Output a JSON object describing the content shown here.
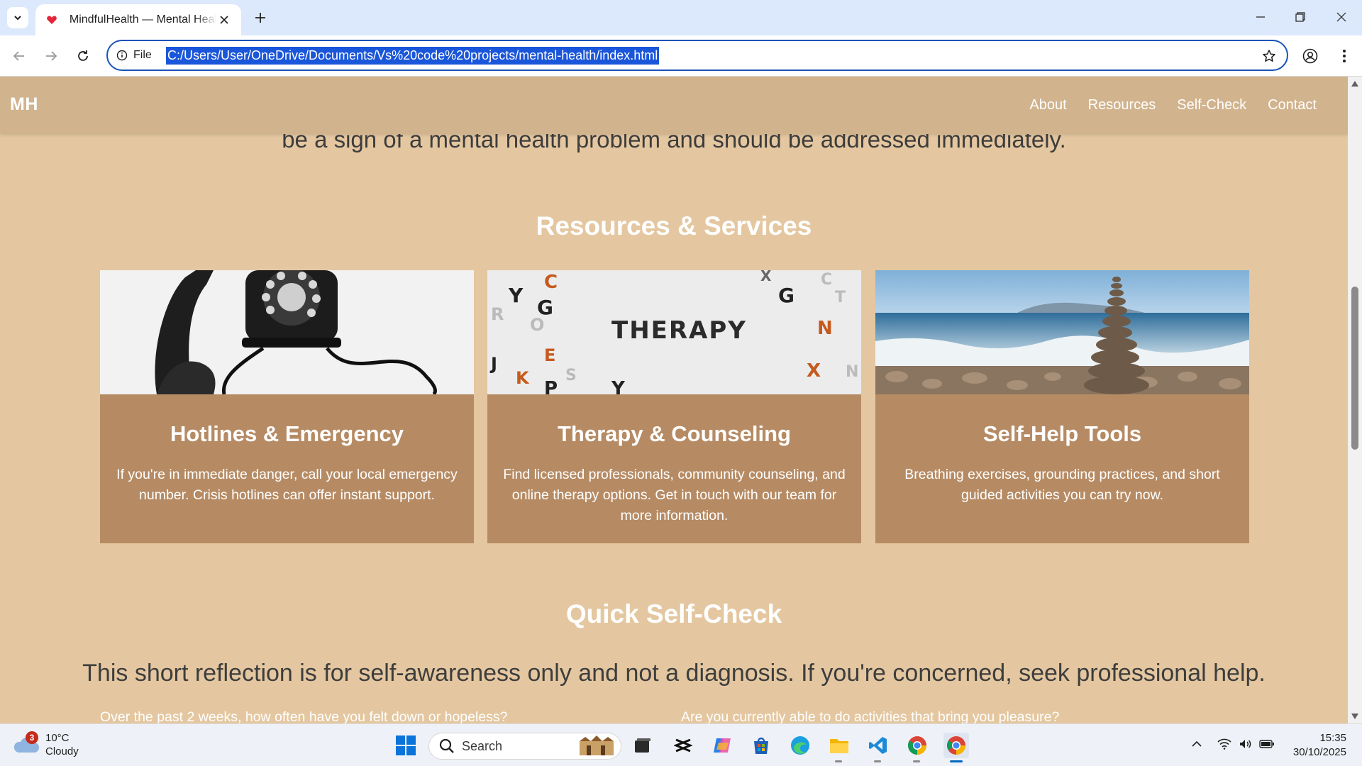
{
  "browser": {
    "tab_title": "MindfulHealth — Mental Health",
    "url_scheme_label": "File",
    "url": "C:/Users/User/OneDrive/Documents/Vs%20code%20projects/mental-health/index.html"
  },
  "site": {
    "logo": "MH",
    "nav": [
      "About",
      "Resources",
      "Self-Check",
      "Contact"
    ]
  },
  "content": {
    "prev_paragraph_tail": "be a sign of a mental health problem and should be addressed immediately.",
    "resources_title": "Resources & Services",
    "cards": [
      {
        "image": "rotary-telephone-photo",
        "title": "Hotlines & Emergency",
        "text": "If you're in immediate danger, call your local emergency number. Crisis hotlines can offer instant support."
      },
      {
        "image": "therapy-letters-photo",
        "image_word": "THERAPY",
        "title": "Therapy & Counseling",
        "text": "Find licensed professionals, community counseling, and online therapy options. Get in touch with our team for more information."
      },
      {
        "image": "stacked-stones-beach-photo",
        "title": "Self-Help Tools",
        "text": "Breathing exercises, grounding practices, and short guided activities you can try now."
      }
    ],
    "selfcheck_title": "Quick Self-Check",
    "selfcheck_intro": "This short reflection is for self-awareness only and not a diagnosis. If you're concerned, seek professional help.",
    "questions": [
      "Over the past 2 weeks, how often have you felt down or hopeless?",
      "Are you currently able to do activities that bring you pleasure?"
    ]
  },
  "taskbar": {
    "weather_badge": "3",
    "temperature": "10°C",
    "condition": "Cloudy",
    "search_label": "Search",
    "time": "15:35",
    "date": "30/10/2025"
  },
  "colors": {
    "page_bg": "#e4c7a0",
    "header_bg": "#d1b38d",
    "card_bg": "#b68b64",
    "url_highlight": "#1a56d9"
  }
}
